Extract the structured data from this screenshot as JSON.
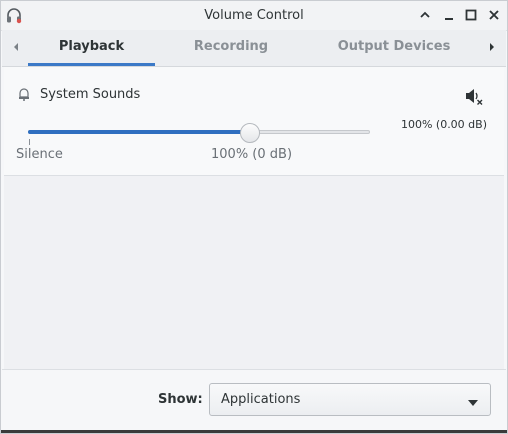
{
  "window": {
    "title": "Volume Control",
    "icon": "headphones-icon"
  },
  "titlebar_buttons": [
    {
      "name": "shade-up-icon"
    },
    {
      "name": "minimize-icon"
    },
    {
      "name": "maximize-icon"
    },
    {
      "name": "close-icon"
    }
  ],
  "tabs": {
    "items": [
      {
        "label": "Playback",
        "active": true
      },
      {
        "label": "Recording",
        "active": false
      },
      {
        "label": "Output Devices",
        "active": false
      }
    ],
    "left_arrow": "chevron-left-icon",
    "right_arrow": "chevron-right-icon"
  },
  "stream": {
    "icon": "bell-icon",
    "name": "System Sounds",
    "mute_icon": "speaker-muted-icon",
    "volume_readout": "100% (0.00 dB)",
    "volume_fraction": 0.65,
    "marks": {
      "silence": "Silence",
      "hundred": "100% (0 dB)"
    }
  },
  "footer": {
    "show_label": "Show:",
    "show_value": "Applications"
  },
  "colors": {
    "accent": "#3b79c7",
    "slider_fill": "#2f6fc0"
  }
}
